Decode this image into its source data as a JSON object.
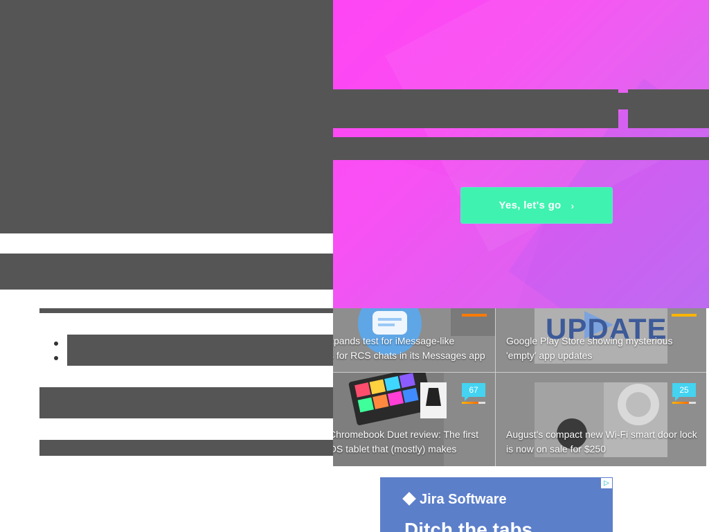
{
  "promo": {
    "cta_label": "Yes, let's go",
    "cta_icon": "chevron-right-icon",
    "colors": {
      "gradient_start": "#ff46f4",
      "gradient_end": "#c76ff0",
      "cta": "#3ff2b0"
    }
  },
  "articles": [
    {
      "title_line1": "xpands test for iMessage-like",
      "title_line2": "s for RCS chats in its Messages app",
      "comments": ""
    },
    {
      "title_line1": "Google Play Store showing mysterious",
      "title_line2": "'empty' app updates",
      "comments": "",
      "thumb_text": "UPDATE"
    },
    {
      "title_line1": "Chromebook Duet review: The first",
      "title_line2": "OS tablet that (mostly) makes",
      "comments": "67"
    },
    {
      "title_line1": "August's compact new Wi-Fi smart door lock",
      "title_line2": "is now on sale for $250",
      "comments": "25"
    }
  ],
  "ad": {
    "brand": "Jira Software",
    "headline": "Ditch the tabs",
    "choices_icon": "adchoices-icon"
  }
}
